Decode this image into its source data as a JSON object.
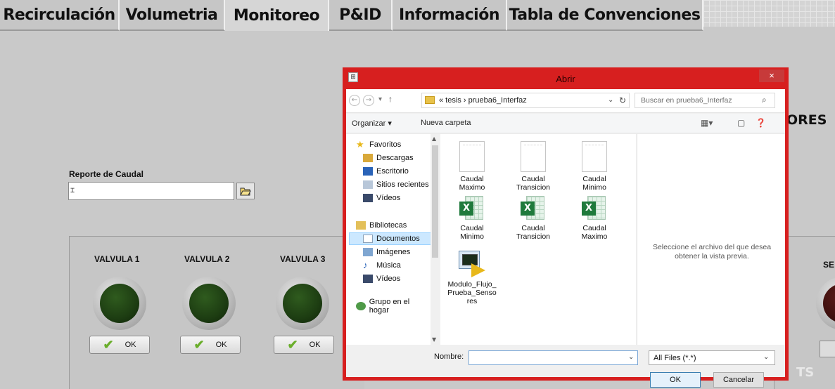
{
  "tabs": [
    {
      "label": "Recirculación"
    },
    {
      "label": "Volumetria"
    },
    {
      "label": "Monitoreo"
    },
    {
      "label": "P&ID"
    },
    {
      "label": "Información"
    },
    {
      "label": "Tabla de Convenciones"
    }
  ],
  "active_tab": "Monitoreo",
  "panel": {
    "report_label": "Reporte de Caudal",
    "path_value": "",
    "valves": [
      {
        "label": "VALVULA 1",
        "button": "OK"
      },
      {
        "label": "VALVULA 2",
        "button": "OK"
      },
      {
        "label": "VALVULA 3",
        "button": "OK"
      }
    ],
    "partial_heading": "ORES",
    "partial_right_label": "SE",
    "watermark": "TS"
  },
  "dialog": {
    "title": "Abrir",
    "close": "×",
    "breadcrumb": "« tesis › prueba6_Interfaz",
    "search_placeholder": "Buscar en prueba6_Interfaz",
    "organize": "Organizar ▾",
    "new_folder": "Nueva carpeta",
    "nav": [
      {
        "label": "Favoritos",
        "type": "star"
      },
      {
        "label": "Descargas",
        "type": "folder"
      },
      {
        "label": "Escritorio",
        "type": "desktop"
      },
      {
        "label": "Sitios recientes",
        "type": "recent"
      },
      {
        "label": "Vídeos",
        "type": "video"
      },
      {
        "label": "Bibliotecas",
        "type": "library"
      },
      {
        "label": "Documentos",
        "type": "docs",
        "selected": true
      },
      {
        "label": "Imágenes",
        "type": "images"
      },
      {
        "label": "Música",
        "type": "music"
      },
      {
        "label": "Vídeos",
        "type": "video"
      },
      {
        "label": "Grupo en el hogar",
        "type": "group"
      }
    ],
    "files": [
      {
        "name": "Caudal Maximo",
        "icon": "document-icon"
      },
      {
        "name": "Caudal Transicion",
        "icon": "document-icon"
      },
      {
        "name": "Caudal Minimo",
        "icon": "document-icon"
      },
      {
        "name": "Caudal Minimo",
        "icon": "excel-icon"
      },
      {
        "name": "Caudal Transicion",
        "icon": "excel-icon"
      },
      {
        "name": "Caudal Maximo",
        "icon": "excel-icon"
      },
      {
        "name": "Modulo_Flujo_Prueba_Sensores",
        "icon": "labview-vi-icon"
      }
    ],
    "preview_text": "Seleccione el archivo del que desea obtener la vista previa.",
    "name_label": "Nombre:",
    "name_value": "",
    "filter": "All Files (*.*)",
    "ok": "OK",
    "cancel": "Cancelar"
  },
  "colors": {
    "dialog_border": "#d71f1f",
    "led_green": "#1d3d12",
    "selection": "#cce8ff"
  }
}
